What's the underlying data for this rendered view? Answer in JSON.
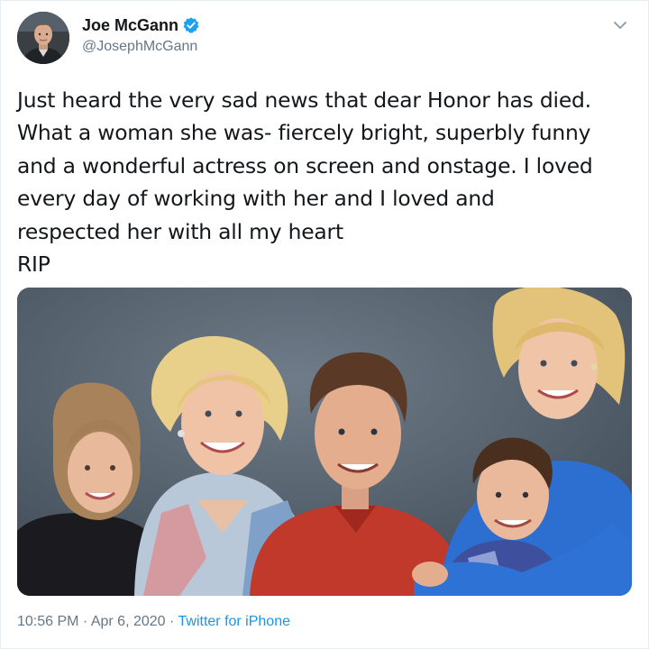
{
  "user": {
    "display_name": "Joe McGann",
    "handle": "@JosephMcGann",
    "verified": true,
    "verified_icon": "verified-badge-icon",
    "verified_color": "#1da1f2"
  },
  "menu": {
    "icon": "chevron-down-icon"
  },
  "tweet": {
    "text": "Just heard the very sad news that dear Honor has died.\nWhat a woman she was- fiercely bright, superbly funny\nand a wonderful actress on screen and onstage. I loved\nevery day of working with her and I loved and\nrespected her with all my heart\nRIP"
  },
  "footer": {
    "time": "10:56 PM",
    "separator": " · ",
    "date": "Apr 6, 2020",
    "source": "Twitter for iPhone",
    "link_color": "#1b95e0"
  }
}
